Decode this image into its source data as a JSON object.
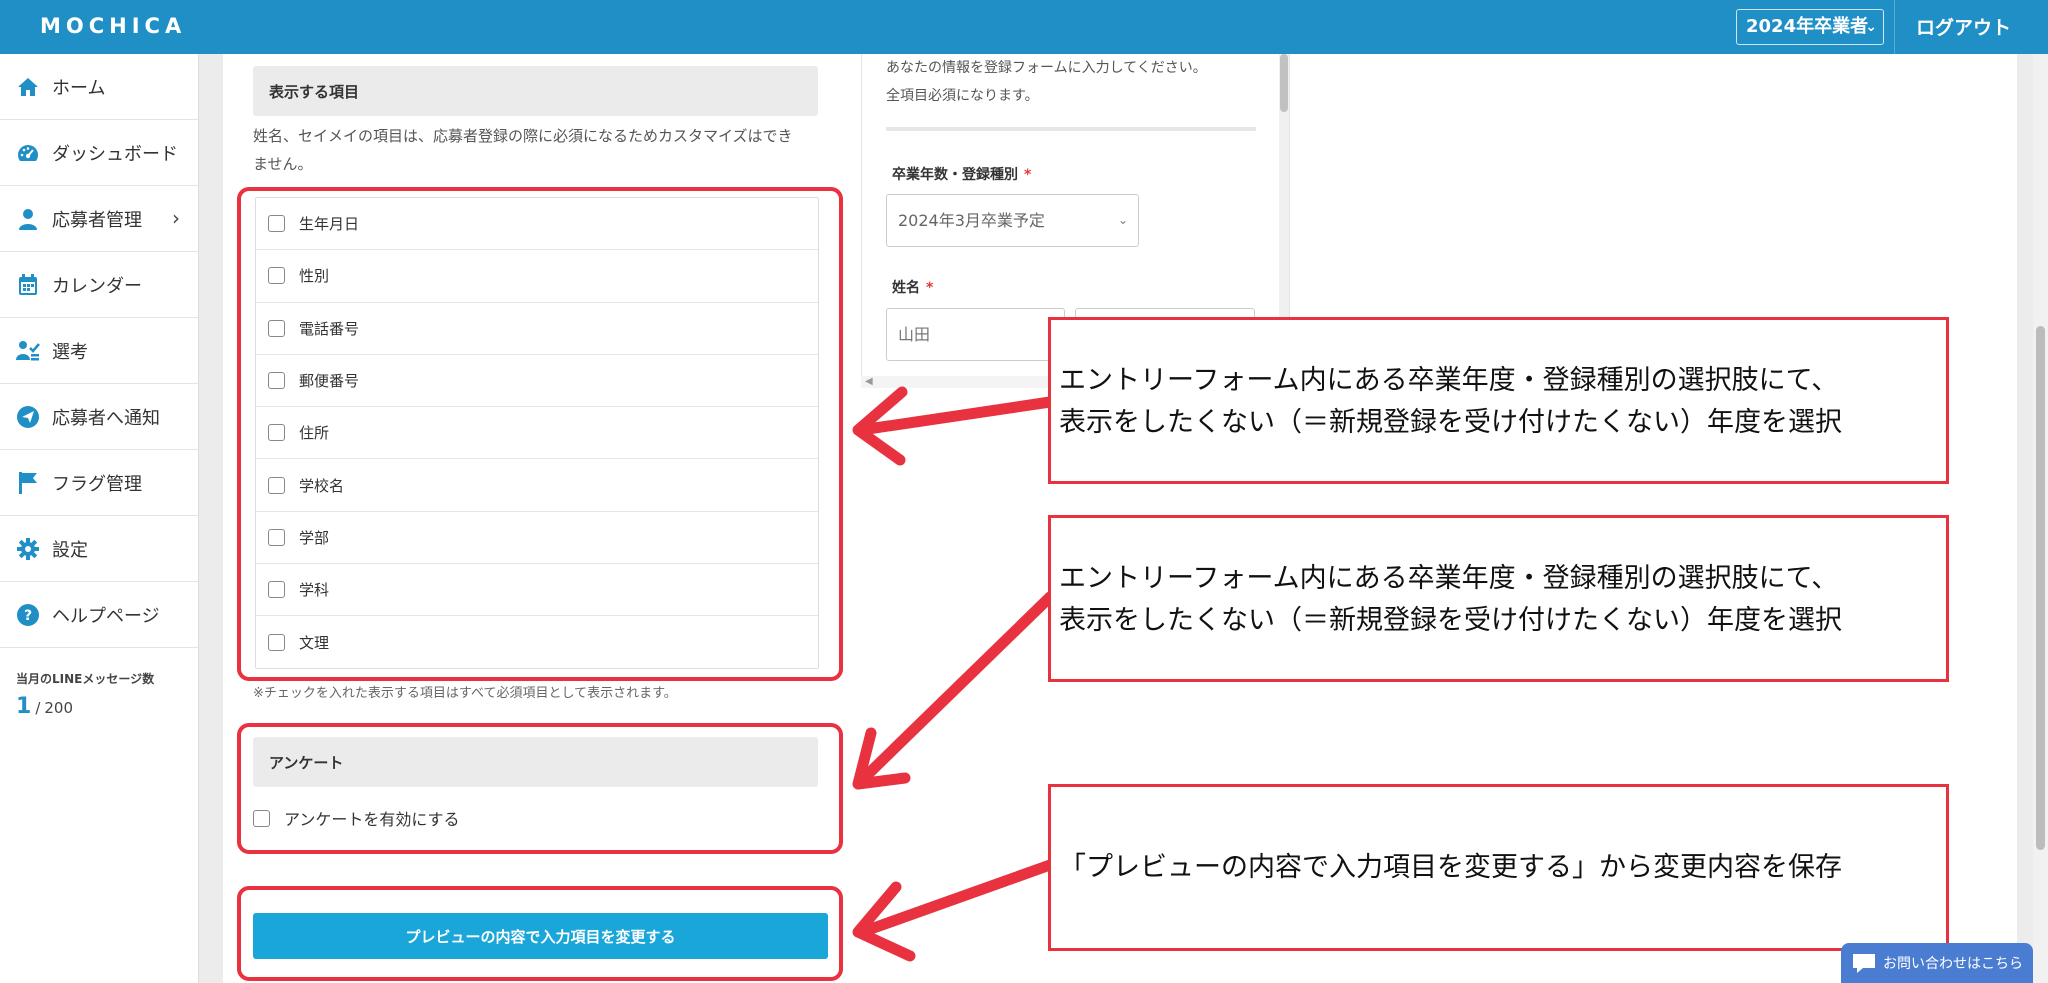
{
  "header": {
    "logo": "MOCHICA",
    "year_select": "2024年卒業者",
    "logout": "ログアウト"
  },
  "sidebar": {
    "items": [
      {
        "label": "ホーム",
        "icon": "home-icon"
      },
      {
        "label": "ダッシュボード",
        "icon": "dashboard-icon"
      },
      {
        "label": "応募者管理",
        "icon": "user-icon"
      },
      {
        "label": "カレンダー",
        "icon": "calendar-icon"
      },
      {
        "label": "選考",
        "icon": "selection-icon"
      },
      {
        "label": "応募者へ通知",
        "icon": "send-icon"
      },
      {
        "label": "フラグ管理",
        "icon": "flag-icon"
      },
      {
        "label": "設定",
        "icon": "gear-icon"
      },
      {
        "label": "ヘルプページ",
        "icon": "help-icon"
      }
    ],
    "line_count_label": "当月のLINEメッセージ数",
    "line_count_value": "1",
    "line_count_sep": "/",
    "line_count_max": "200"
  },
  "settings": {
    "display_items_header": "表示する項目",
    "display_items_note_1": "姓名、セイメイの項目は、応募者登録の際に必須になるためカスタマイズはでき",
    "display_items_note_2": "ません。",
    "fields": [
      {
        "label": "生年月日",
        "checked": false
      },
      {
        "label": "性別",
        "checked": false
      },
      {
        "label": "電話番号",
        "checked": false
      },
      {
        "label": "郵便番号",
        "checked": false
      },
      {
        "label": "住所",
        "checked": false
      },
      {
        "label": "学校名",
        "checked": false
      },
      {
        "label": "学部",
        "checked": false
      },
      {
        "label": "学科",
        "checked": false
      },
      {
        "label": "文理",
        "checked": false
      }
    ],
    "fields_note": "※チェックを入れた表示する項目はすべて必須項目として表示されます。",
    "survey_header": "アンケート",
    "survey_enable_label": "アンケートを有効にする",
    "survey_enabled": false,
    "save_button": "プレビューの内容で入力項目を変更する"
  },
  "preview": {
    "intro_1": "あなたの情報を登録フォームに入力してください。",
    "intro_2": "全項目必須になります。",
    "grad_label": "卒業年数・登録種別",
    "grad_value": "2024年3月卒業予定",
    "name_label": "姓名",
    "required_mark": "*",
    "last_name_value": "山田"
  },
  "annotations": {
    "callout_1_line_1": "エントリーフォーム内にある卒業年度・登録種別の選択肢にて、",
    "callout_1_line_2": "表示をしたくない（＝新規登録を受け付けたくない）年度を選択",
    "callout_2_line_1": "エントリーフォーム内にある卒業年度・登録種別の選択肢にて、",
    "callout_2_line_2": "表示をしたくない（＝新規登録を受け付けたくない）年度を選択",
    "callout_3_line_1": "「プレビューの内容で入力項目を変更する」から変更内容を保存",
    "accent_color": "#e8323f"
  },
  "contact": {
    "label": "お問い合わせはこちら"
  },
  "colors": {
    "header_bg": "#1f8fc6",
    "button_bg": "#1aa6d9"
  }
}
